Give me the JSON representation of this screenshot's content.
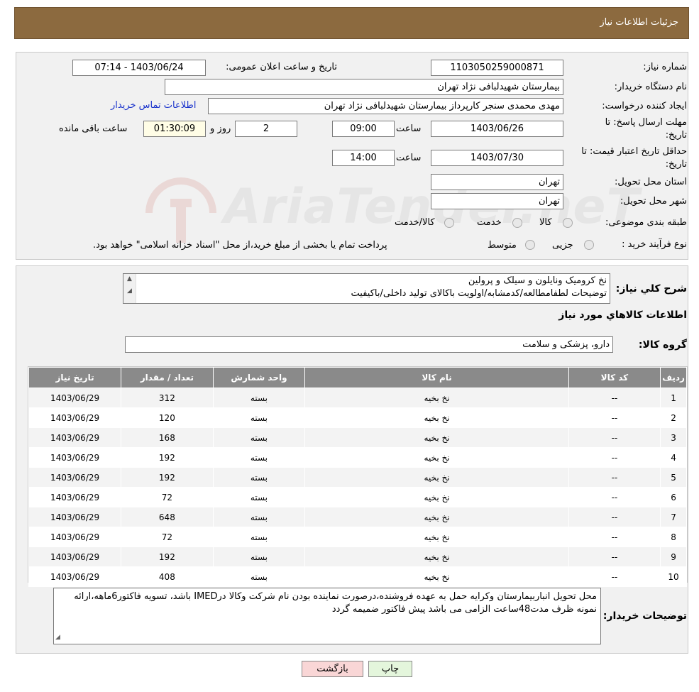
{
  "header": {
    "title": "جزئیات اطلاعات نیاز"
  },
  "fields": {
    "need_number_label": "شماره نیاز:",
    "need_number": "1103050259000871",
    "announce_label": "تاریخ و ساعت اعلان عمومی:",
    "announce_value": "1403/06/24 - 07:14",
    "buyer_org_label": "نام دستگاه خریدار:",
    "buyer_org": "بیمارستان شهیدلبافی نژاد تهران",
    "creator_label": "ایجاد کننده درخواست:",
    "creator": "مهدی محمدی سنجر کارپرداز بیمارستان شهیدلبافی نژاد تهران",
    "contact_link": "اطلاعات تماس خریدار",
    "deadline_label_1": "مهلت ارسال پاسخ: تا",
    "deadline_label_2": "تاریخ:",
    "deadline_date": "1403/06/26",
    "hour_label": "ساعت",
    "deadline_time": "09:00",
    "days_value": "2",
    "days_label": "روز و",
    "remaining_time": "01:30:09",
    "remaining_label": "ساعت باقی مانده",
    "validity_label_1": "حداقل تاریخ اعتبار قیمت: تا",
    "validity_label_2": "تاریخ:",
    "validity_date": "1403/07/30",
    "validity_time": "14:00",
    "province_label": "استان محل تحویل:",
    "province": "تهران",
    "city_label": "شهر محل تحویل:",
    "city": "تهران",
    "category_label": "طبقه بندی موضوعی:",
    "category_options": [
      "کالا",
      "خدمت",
      "کالا/خدمت"
    ],
    "process_label": "نوع فرآیند خرید :",
    "process_options": [
      "جزیی",
      "متوسط"
    ],
    "process_note": "پرداخت تمام یا بخشی از مبلغ خرید،از محل \"اسناد خزانه اسلامی\" خواهد بود."
  },
  "summary": {
    "label": "شرح کلي نياز:",
    "lines": [
      "نخ کرومیک ونایلون و سیلک و پرولین",
      "توضیحات لطفامطالعه/کدمشابه/اولویت باکالای تولید داخلی/باکیفیت"
    ]
  },
  "goods_section_title": "اطلاعات کالاهاي مورد نياز",
  "goods_group_label": "گروه کالا:",
  "goods_group": "دارو، پزشکی و سلامت",
  "table": {
    "columns": [
      "رديف",
      "کد کالا",
      "نام کالا",
      "واحد شمارش",
      "تعداد / مقدار",
      "تاريخ نياز"
    ],
    "rows": [
      [
        "1",
        "--",
        "نخ بخیه",
        "بسته",
        "312",
        "1403/06/29"
      ],
      [
        "2",
        "--",
        "نخ بخیه",
        "بسته",
        "120",
        "1403/06/29"
      ],
      [
        "3",
        "--",
        "نخ بخیه",
        "بسته",
        "168",
        "1403/06/29"
      ],
      [
        "4",
        "--",
        "نخ بخیه",
        "بسته",
        "192",
        "1403/06/29"
      ],
      [
        "5",
        "--",
        "نخ بخیه",
        "بسته",
        "192",
        "1403/06/29"
      ],
      [
        "6",
        "--",
        "نخ بخیه",
        "بسته",
        "72",
        "1403/06/29"
      ],
      [
        "7",
        "--",
        "نخ بخیه",
        "بسته",
        "648",
        "1403/06/29"
      ],
      [
        "8",
        "--",
        "نخ بخیه",
        "بسته",
        "72",
        "1403/06/29"
      ],
      [
        "9",
        "--",
        "نخ بخیه",
        "بسته",
        "192",
        "1403/06/29"
      ],
      [
        "10",
        "--",
        "نخ بخیه",
        "بسته",
        "408",
        "1403/06/29"
      ]
    ]
  },
  "buyer_notes": {
    "label": "توضیحات خریدار:",
    "text": "محل تحویل انباربیمارستان وکرایه حمل به عهده فروشنده،درصورت نماینده بودن نام شرکت وکالا درIMED باشد، تسویه فاکتور6ماهه،ارائه نمونه ظرف مدت48ساعت الزامی می باشد پیش فاکتور ضمیمه گردد"
  },
  "buttons": {
    "print": "چاپ",
    "back": "بازگشت"
  },
  "watermark": {
    "text": "AriaTender.neT"
  },
  "colors": {
    "header_bg": "#8c6a3f",
    "table_header": "#8a8a8a",
    "link": "#1a33cc",
    "back_btn": "#f9d6d6",
    "print_btn": "#e4f6dc"
  }
}
